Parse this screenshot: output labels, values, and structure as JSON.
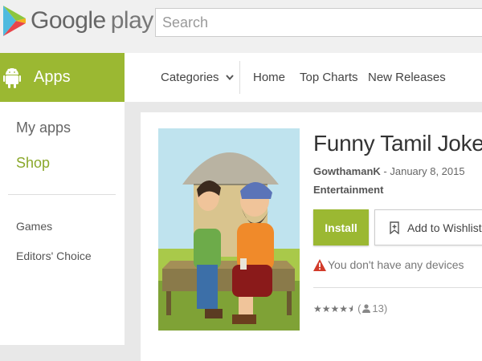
{
  "header": {
    "brand_google": "Google",
    "brand_play": "play",
    "search_placeholder": "Search"
  },
  "nav": {
    "apps_label": "Apps",
    "categories_label": "Categories",
    "home_label": "Home",
    "top_charts_label": "Top Charts",
    "new_releases_label": "New Releases"
  },
  "sidebar": {
    "my_apps": "My apps",
    "shop": "Shop",
    "games": "Games",
    "editors_choice": "Editors' Choice"
  },
  "app": {
    "title": "Funny Tamil Jokes",
    "developer": "GowthamanK",
    "date_sep": " - ",
    "date": "January 8, 2015",
    "category": "Entertainment",
    "install_label": "Install",
    "wishlist_label": "Add to Wishlist",
    "warning_text": "You don't have any devices",
    "rating_stars": 4.5,
    "rating_paren_open": "(",
    "rating_count": "13",
    "rating_paren_close": ")"
  },
  "colors": {
    "brand_green": "#9bb832",
    "shop_green": "#8aa82a",
    "warning_red": "#d23b2a"
  },
  "icons": {
    "logo": "google-play-triangle-icon",
    "apps": "android-icon",
    "categories_chevron": "chevron-down-icon",
    "wishlist": "bookmark-plus-icon",
    "warning": "warning-triangle-icon",
    "rating_person": "person-icon"
  }
}
